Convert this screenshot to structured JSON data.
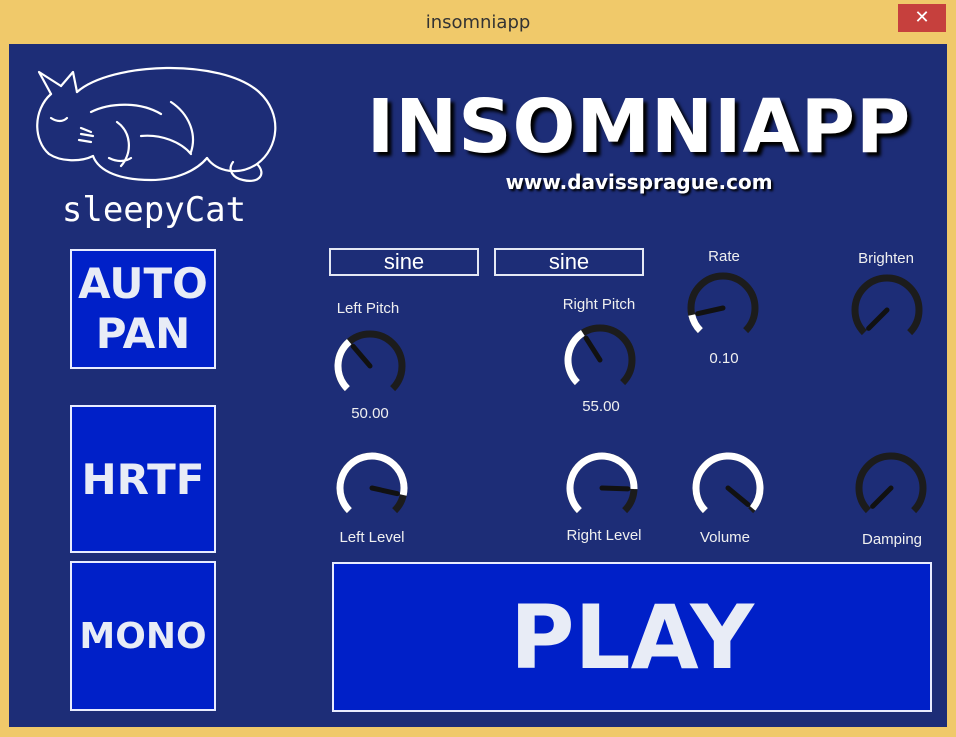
{
  "window": {
    "title": "insomniapp",
    "close_glyph": "✕"
  },
  "logo": {
    "text": "sleepyCat",
    "icon": "sleeping-cat"
  },
  "header": {
    "title": "INSOMNIAPP",
    "url": "www.davissprague.com"
  },
  "side_buttons": {
    "autopan": {
      "line1": "AUTO",
      "line2": "PAN"
    },
    "hrtf": "HRTF",
    "mono": "MONO"
  },
  "waveforms": {
    "left": "sine",
    "right": "sine"
  },
  "knobs": {
    "left_pitch": {
      "label": "Left Pitch",
      "value": "50.00",
      "level": 0.35
    },
    "right_pitch": {
      "label": "Right Pitch",
      "value": "55.00",
      "level": 0.38
    },
    "rate": {
      "label": "Rate",
      "value": "0.10",
      "level": 0.12
    },
    "brighten": {
      "label": "Brighten",
      "level": 0.0
    },
    "left_level": {
      "label": "Left Level",
      "level": 0.88
    },
    "right_level": {
      "label": "Right Level",
      "level": 0.84
    },
    "volume": {
      "label": "Volume",
      "level": 0.98
    },
    "damping": {
      "label": "Damping",
      "level": 0.0
    }
  },
  "play": {
    "label": "PLAY"
  },
  "colors": {
    "panel": "#1d2d77",
    "button": "#0020c8",
    "knob_track": "#1c1c1c",
    "knob_fill": "#ffffff",
    "frame": "#f0c96a",
    "close": "#c6403d"
  }
}
